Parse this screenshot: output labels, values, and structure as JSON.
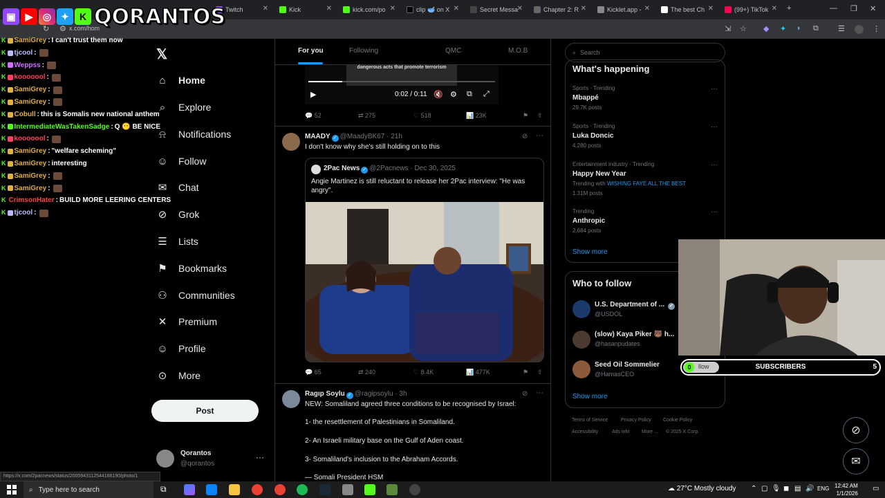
{
  "browser": {
    "tabs": [
      {
        "label": "Twitch",
        "color": "#9146ff"
      },
      {
        "label": "Kick",
        "color": "#53fc18"
      },
      {
        "label": "kick.com/po",
        "color": "#53fc18"
      },
      {
        "label": "clip 🥣 on X",
        "color": "#000000"
      },
      {
        "label": "Secret Messa",
        "color": "#444444"
      },
      {
        "label": "Chapter 2: R",
        "color": "#666666"
      },
      {
        "label": "Kicklet.app -",
        "color": "#888888"
      },
      {
        "label": "The best Ch",
        "color": "#ffffff"
      },
      {
        "label": "(99+) TikTok",
        "color": "#ff0050"
      }
    ],
    "url": "x.com/hom",
    "status_url": "https://x.com/2pacnews/status/2005943112544166190/photo/1"
  },
  "overlay": {
    "logo_text": "QORANTOS",
    "chat": [
      {
        "user": "SamiGrey",
        "user_color": "#e0b040",
        "message": "I can't trust them now",
        "emote": false
      },
      {
        "user": "tjcool",
        "user_color": "#bbbbff",
        "message": "",
        "emote": true
      },
      {
        "user": "Weppss",
        "user_color": "#d070ff",
        "message": "",
        "emote": true
      },
      {
        "user": "kooooool",
        "user_color": "#ff4060",
        "message": "",
        "emote": true
      },
      {
        "user": "SamiGrey",
        "user_color": "#e0b040",
        "message": "",
        "emote": true
      },
      {
        "user": "SamiGrey",
        "user_color": "#e0b040",
        "message": "",
        "emote": true
      },
      {
        "user": "Cobull",
        "user_color": "#e0b040",
        "message": "this is Somalis new national anthem",
        "emote": false
      },
      {
        "user": "IntermediateWasTakenSadge",
        "user_color": "#53fc18",
        "message": "Q 😶 BE NICE",
        "emote": false
      },
      {
        "user": "kooooool",
        "user_color": "#ff4060",
        "message": "",
        "emote": true
      },
      {
        "user": "SamiGrey",
        "user_color": "#e0b040",
        "message": "\"welfare scheming\"",
        "emote": false
      },
      {
        "user": "SamiGrey",
        "user_color": "#e0b040",
        "message": "interesting",
        "emote": false
      },
      {
        "user": "SamiGrey",
        "user_color": "#e0b040",
        "message": "",
        "emote": true
      },
      {
        "user": "SamiGrey",
        "user_color": "#e0b040",
        "message": "",
        "emote": true
      },
      {
        "user": "CrimsonHater",
        "user_color": "#ff4040",
        "message": "BUILD MORE LEERING CENTERS",
        "emote": false
      },
      {
        "user": "tjcool",
        "user_color": "#bbbbff",
        "message": "",
        "emote": true
      }
    ],
    "subscribers": {
      "label": "SUBSCRIBERS",
      "min": "0",
      "max": "5",
      "progress": 0.18
    }
  },
  "nav": {
    "items": [
      {
        "label": "Home",
        "icon": "home-icon",
        "glyph": "⌂"
      },
      {
        "label": "Explore",
        "icon": "search-icon",
        "glyph": "⌕"
      },
      {
        "label": "Notifications",
        "icon": "bell-icon",
        "glyph": "⍾"
      },
      {
        "label": "Follow",
        "icon": "follow-icon",
        "glyph": "☺"
      },
      {
        "label": "Chat",
        "icon": "mail-icon",
        "glyph": "✉"
      },
      {
        "label": "Grok",
        "icon": "grok-icon",
        "glyph": "⊘"
      },
      {
        "label": "Lists",
        "icon": "list-icon",
        "glyph": "☰"
      },
      {
        "label": "Bookmarks",
        "icon": "bookmark-icon",
        "glyph": "⚑"
      },
      {
        "label": "Communities",
        "icon": "communities-icon",
        "glyph": "⚇"
      },
      {
        "label": "Premium",
        "icon": "x-premium-icon",
        "glyph": "✕"
      },
      {
        "label": "Profile",
        "icon": "profile-icon",
        "glyph": "☺"
      },
      {
        "label": "More",
        "icon": "more-circle-icon",
        "glyph": "⊙"
      }
    ],
    "post_label": "Post",
    "account": {
      "name": "Qorantos",
      "handle": "@qorantos"
    }
  },
  "feed": {
    "tabs": [
      "For you",
      "Following",
      "QMC",
      "M.O.B"
    ],
    "video": {
      "caption": "dangerous acts that promote terrorism",
      "time": "0:02 / 0:11",
      "progress": 0.18
    },
    "video_stats": {
      "replies": "52",
      "reposts": "275",
      "likes": "518",
      "views": "23K"
    },
    "tweet1": {
      "name": "MAADY",
      "handle": "@MaadyBK67",
      "time": "21h",
      "text": "I don't know why she's still holding on to this",
      "quote": {
        "name": "2Pac News",
        "handle": "@2Pacnews",
        "date": "Dec 30, 2025",
        "text": "Angie Martinez is still reluctant to release her 2Pac interview: \"He was angry\"."
      },
      "stats": {
        "replies": "65",
        "reposts": "240",
        "likes": "8.4K",
        "views": "477K"
      }
    },
    "tweet2": {
      "name": "Ragıp Soylu",
      "handle": "@ragipsoylu",
      "time": "3h",
      "lines": [
        "NEW: Somaliland agreed three conditions to be recognised by Israel:",
        "1- the resettlement of Palestinians in Somaliland.",
        "2-  An Israeli military base on the Gulf of Aden coast.",
        "3- Somaliland's inclusion to the Abraham Accords.",
        "— Somali President HSM"
      ]
    }
  },
  "sidebar": {
    "search_placeholder": "Search",
    "happening_title": "What's happening",
    "trends": [
      {
        "category": "Sports · Trending",
        "name": "Mbappé",
        "extra": "",
        "posts": "29.7K posts"
      },
      {
        "category": "Sports · Trending",
        "name": "Luka Doncic",
        "extra": "",
        "posts": "4,280 posts"
      },
      {
        "category": "Entertainment industry · Trending",
        "name": "Happy New Year",
        "extra": "Trending with",
        "extra_link": "WISHING FAYE ALL THE BEST",
        "posts": "1.31M posts"
      },
      {
        "category": "Trending",
        "name": "Anthropic",
        "extra": "",
        "posts": "2,684 posts"
      }
    ],
    "show_more": "Show more",
    "wtf_title": "Who to follow",
    "wtf": [
      {
        "name": "U.S. Department of ...",
        "handle": "@USDOL"
      },
      {
        "name": "(slow) Kaya Piker 🐻 h...",
        "handle": "@hasanpudates"
      },
      {
        "name": "Seed Oil Sommelier",
        "handle": "@HamasCEO"
      }
    ],
    "follow_partial": "llow",
    "footer": [
      "Terms of Service",
      "Privacy Policy",
      "Cookie Policy",
      "Accessibility",
      "Ads info",
      "More …",
      "© 2025 X Corp."
    ]
  },
  "taskbar": {
    "search_placeholder": "Type here to search",
    "weather": "27°C  Mostly cloudy",
    "lang": "ENG",
    "time": "12:42 AM",
    "date": "1/1/2026"
  }
}
